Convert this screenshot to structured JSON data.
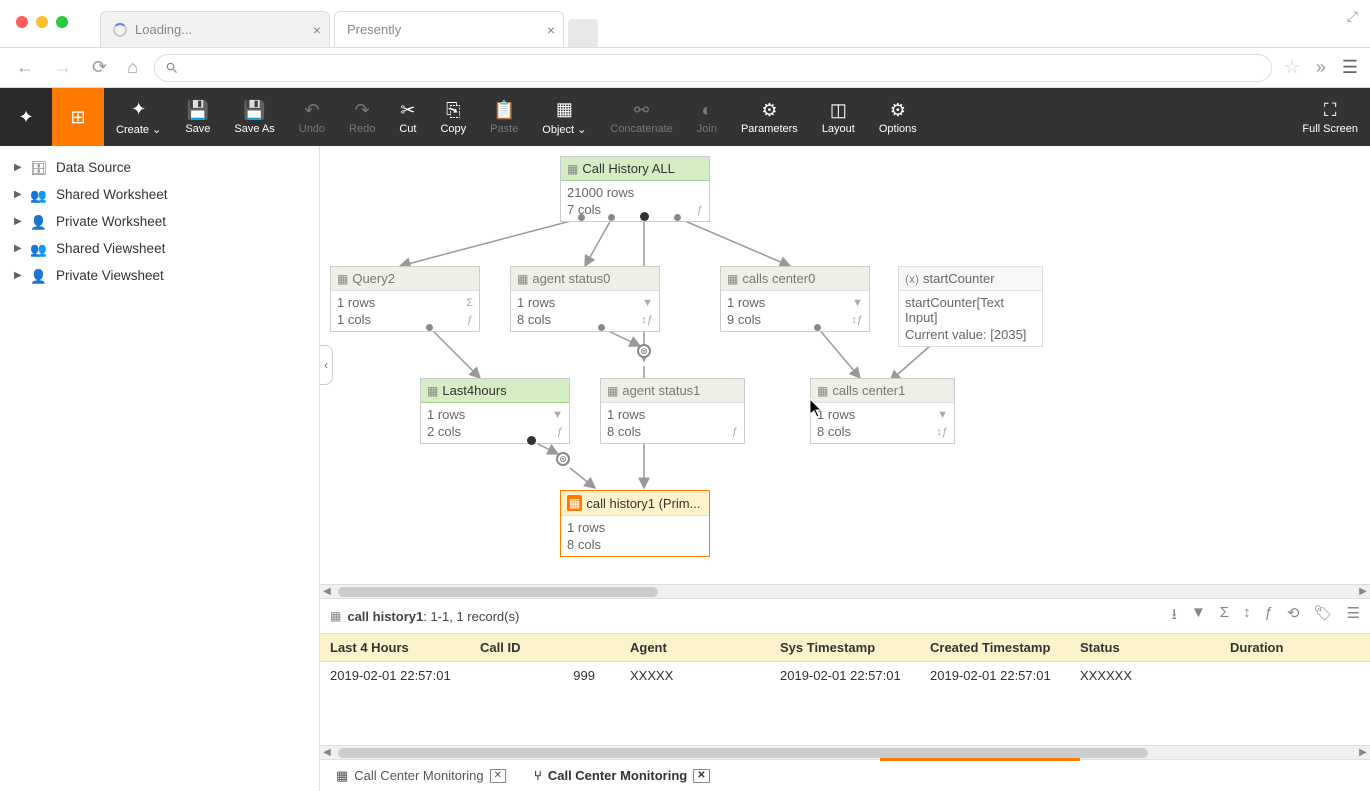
{
  "browser": {
    "tabs": [
      {
        "label": "Loading..."
      },
      {
        "label": "Presently"
      }
    ]
  },
  "appToolbar": {
    "create": "Create",
    "save": "Save",
    "saveAs": "Save As",
    "undo": "Undo",
    "redo": "Redo",
    "cut": "Cut",
    "copy": "Copy",
    "paste": "Paste",
    "object": "Object",
    "concat": "Concatenate",
    "join": "Join",
    "params": "Parameters",
    "layout": "Layout",
    "options": "Options",
    "fullscreen": "Full Screen"
  },
  "sidebar": {
    "items": [
      "Data Source",
      "Shared Worksheet",
      "Private Worksheet",
      "Shared Viewsheet",
      "Private Viewsheet"
    ]
  },
  "nodes": {
    "callHistoryAll": {
      "title": "Call History ALL",
      "rows": "21000 rows",
      "cols": "7 cols"
    },
    "query2": {
      "title": "Query2",
      "rows": "1 rows",
      "cols": "1 cols"
    },
    "agentStatus0": {
      "title": "agent status0",
      "rows": "1 rows",
      "cols": "8 cols"
    },
    "callsCenter0": {
      "title": "calls center0",
      "rows": "1 rows",
      "cols": "9 cols"
    },
    "startCounter": {
      "title": "startCounter",
      "line1": "startCounter[Text Input]",
      "line2": "Current value: [2035]"
    },
    "last4hours": {
      "title": "Last4hours",
      "rows": "1 rows",
      "cols": "2 cols"
    },
    "agentStatus1": {
      "title": "agent status1",
      "rows": "1 rows",
      "cols": "8 cols"
    },
    "callsCenter1": {
      "title": "calls center1",
      "rows": "1 rows",
      "cols": "8 cols"
    },
    "callHistory1": {
      "title": "call history1 (Prim...",
      "rows": "1 rows",
      "cols": "8 cols"
    }
  },
  "detail": {
    "title": "call history1",
    "suffix": ": 1-1, 1 record(s)",
    "headers": [
      "Last 4 Hours",
      "Call ID",
      "Agent",
      "Sys Timestamp",
      "Created Timestamp",
      "Status",
      "Duration"
    ],
    "row": {
      "last4": "2019-02-01 22:57:01",
      "callId": "999",
      "agent": "XXXXX",
      "sys": "2019-02-01 22:57:01",
      "created": "2019-02-01 22:57:01",
      "status": "XXXXXX",
      "duration": ""
    }
  },
  "bottomTabs": {
    "t1": "Call Center Monitoring",
    "t2": "Call Center Monitoring"
  }
}
